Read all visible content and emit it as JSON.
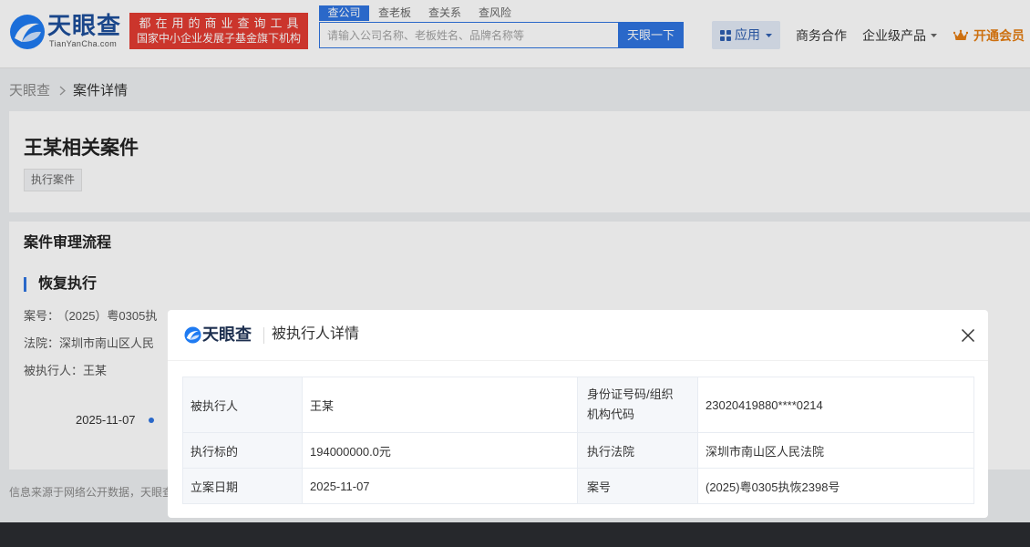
{
  "header": {
    "logo_text": "天眼查",
    "logo_domain": "TianYanCha.com",
    "slogan_line1": "都在用的商业查询工具",
    "slogan_line2": "国家中小企业发展子基金旗下机构",
    "search_tabs": [
      {
        "label": "查公司",
        "active": true
      },
      {
        "label": "查老板",
        "active": false
      },
      {
        "label": "查关系",
        "active": false
      },
      {
        "label": "查风险",
        "active": false
      }
    ],
    "search_placeholder": "请输入公司名称、老板姓名、品牌名称等",
    "search_button": "天眼一下",
    "apps_label": "应用",
    "nav": {
      "business": "商务合作",
      "enterprise": "企业级产品",
      "vip": "开通会员"
    }
  },
  "breadcrumb": {
    "home": "天眼查",
    "current": "案件详情"
  },
  "case_header": {
    "title": "王某相关案件",
    "tag": "执行案件"
  },
  "process": {
    "section_title": "案件审理流程",
    "stage_title": "恢复执行",
    "case_no_label": "案号：",
    "case_no_value": "（2025）粤0305执",
    "court_label": "法院：",
    "court_value": "深圳市南山区人民",
    "executed_label": "被执行人：",
    "executed_value": "王某",
    "timeline_date": "2025-11-07"
  },
  "footer": {
    "source_note": "信息来源于网络公开数据，天眼查"
  },
  "modal": {
    "logo_text": "天眼查",
    "title": "被执行人详情",
    "detail_rows": [
      {
        "left": {
          "label": "被执行人",
          "value": "王某"
        },
        "right": {
          "label": "身份证号码/组织机构代码",
          "value": "23020419880****0214"
        }
      },
      {
        "left": {
          "label": "执行标的",
          "value": "194000000.0元"
        },
        "right": {
          "label": "执行法院",
          "value": "深圳市南山区人民法院"
        }
      },
      {
        "left": {
          "label": "立案日期",
          "value": "2025-11-07"
        },
        "right": {
          "label": "案号",
          "value": "(2025)粤0305执恢2398号"
        }
      }
    ]
  },
  "icons": {
    "logo": "tianyancha-logo-icon",
    "apps": "apps-grid-icon",
    "dropdown": "chevron-down-icon",
    "vip": "crown-icon",
    "breadcrumb_separator": "chevron-right-icon",
    "close": "close-icon"
  },
  "colors": {
    "brand_blue": "#2f74e0",
    "banner_red": "#e23b31",
    "vip_orange": "#e57d12",
    "label_cell_bg": "#f5f7fa"
  }
}
